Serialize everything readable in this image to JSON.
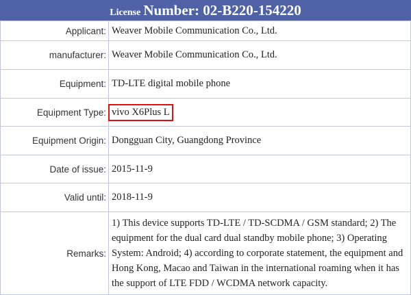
{
  "header": {
    "prefix": "License",
    "number": "Number: 02-B220-154220"
  },
  "rows": [
    {
      "label": "Applicant:",
      "value": "Weaver Mobile Communication Co., Ltd."
    },
    {
      "label": "manufacturer:",
      "value": "Weaver Mobile Communication Co., Ltd."
    },
    {
      "label": "Equipment:",
      "value": "TD-LTE digital mobile phone"
    },
    {
      "label": "Equipment Type:",
      "value": "vivo X6Plus L"
    },
    {
      "label": "Equipment Origin:",
      "value": "Dongguan City, Guangdong Province"
    },
    {
      "label": "Date of issue:",
      "value": "2015-11-9"
    },
    {
      "label": "Valid until:",
      "value": "2018-11-9"
    },
    {
      "label": "Remarks:",
      "value": "1) This device supports TD-LTE / TD-SCDMA / GSM standard; 2) The equipment for the dual card dual standby mobile phone; 3) Operating System: Android; 4) according to corporate statement, the equipment and Hong Kong, Macao and Taiwan in the international roaming when it has the support of LTE FDD / WCDMA network capacity."
    }
  ],
  "colors": {
    "header_bg": "#4f62a6",
    "highlight": "#e01010",
    "border": "#c2c7da"
  }
}
